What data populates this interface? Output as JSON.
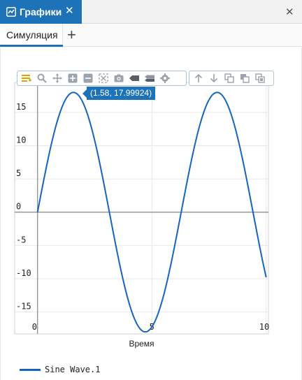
{
  "window": {
    "tab_title": "Графики",
    "tab_close": "✕",
    "close": "✕"
  },
  "subtabs": {
    "active_label": "Симуляция",
    "add_label": "+"
  },
  "toolbar": {
    "group1": [
      "menu-icon",
      "zoom-icon",
      "pan-icon",
      "zoom-in-icon",
      "zoom-out-icon",
      "autoscale-icon",
      "camera-icon",
      "tag-icon",
      "compare-icon",
      "settings-icon"
    ],
    "group2": [
      "arrow-up-icon",
      "arrow-down-icon",
      "copy-icon",
      "paste-icon",
      "clone-icon"
    ]
  },
  "tooltip": {
    "text": "(1.58, 17.99924)"
  },
  "colors": {
    "accent": "#1e73b8",
    "series": "#1565c0",
    "grid": "#e8e8e8",
    "axis": "#888888"
  },
  "chart_data": {
    "type": "line",
    "title": "",
    "xlabel": "Время",
    "ylabel": "",
    "xlim": [
      -1.0,
      10.1
    ],
    "ylim": [
      -18.3,
      19.5
    ],
    "x_ticks": [
      0,
      5,
      10
    ],
    "x_tick_labels": [
      "0",
      "5",
      "10"
    ],
    "y_ticks": [
      15,
      10,
      5,
      0,
      -5,
      -10,
      -15
    ],
    "y_tick_labels": [
      "15",
      "10",
      "5",
      "0",
      "-5",
      "-10",
      "-15"
    ],
    "grid": true,
    "legend_position": "bottom-left",
    "series": [
      {
        "name": "Sine Wave.1",
        "function": "18*sin(x)",
        "x": [
          0,
          0.5,
          1,
          1.58,
          2,
          2.5,
          3,
          3.5,
          4,
          4.5,
          4.71,
          5,
          5.5,
          6,
          6.5,
          7,
          7.5,
          7.85,
          8.5,
          9,
          9.5,
          10
        ],
        "y": [
          0,
          8.63,
          15.15,
          18.0,
          16.37,
          10.77,
          2.54,
          -6.31,
          -13.62,
          -17.59,
          -18.0,
          -17.26,
          -12.7,
          -5.03,
          3.87,
          11.83,
          16.89,
          18.0,
          14.47,
          7.42,
          -1.35,
          -9.79
        ]
      }
    ]
  }
}
